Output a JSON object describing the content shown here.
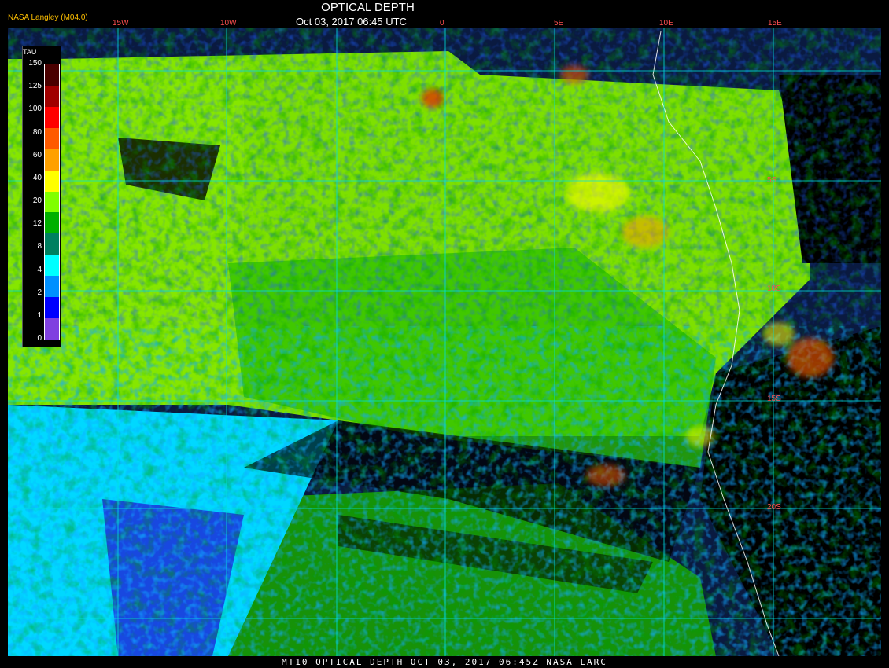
{
  "header": {
    "title": "OPTICAL DEPTH",
    "subtitle": "Oct 03, 2017 06:45 UTC",
    "credit": "NASA Langley (M04.0)"
  },
  "footer": {
    "text": "MT10  OPTICAL DEPTH   OCT 03, 2017 06:45Z  NASA LARC"
  },
  "colorbar": {
    "title": "TAU",
    "labels": [
      "150",
      "125",
      "100",
      "80",
      "60",
      "40",
      "20",
      "12",
      "8",
      "4",
      "2",
      "1",
      "0"
    ],
    "colors": [
      "#4a0000",
      "#a00000",
      "#ff0000",
      "#ff5a00",
      "#ffa000",
      "#ffff00",
      "#80ff00",
      "#00b000",
      "#008060",
      "#00ffff",
      "#0090ff",
      "#0000ff",
      "#8040e0"
    ]
  },
  "grid": {
    "line_color": "#00e0e0",
    "longitude_labels": [
      "15W",
      "10W",
      "0",
      "5E",
      "10E",
      "15E"
    ],
    "latitude_labels": [
      "5S",
      "10S",
      "15S",
      "20S"
    ]
  }
}
